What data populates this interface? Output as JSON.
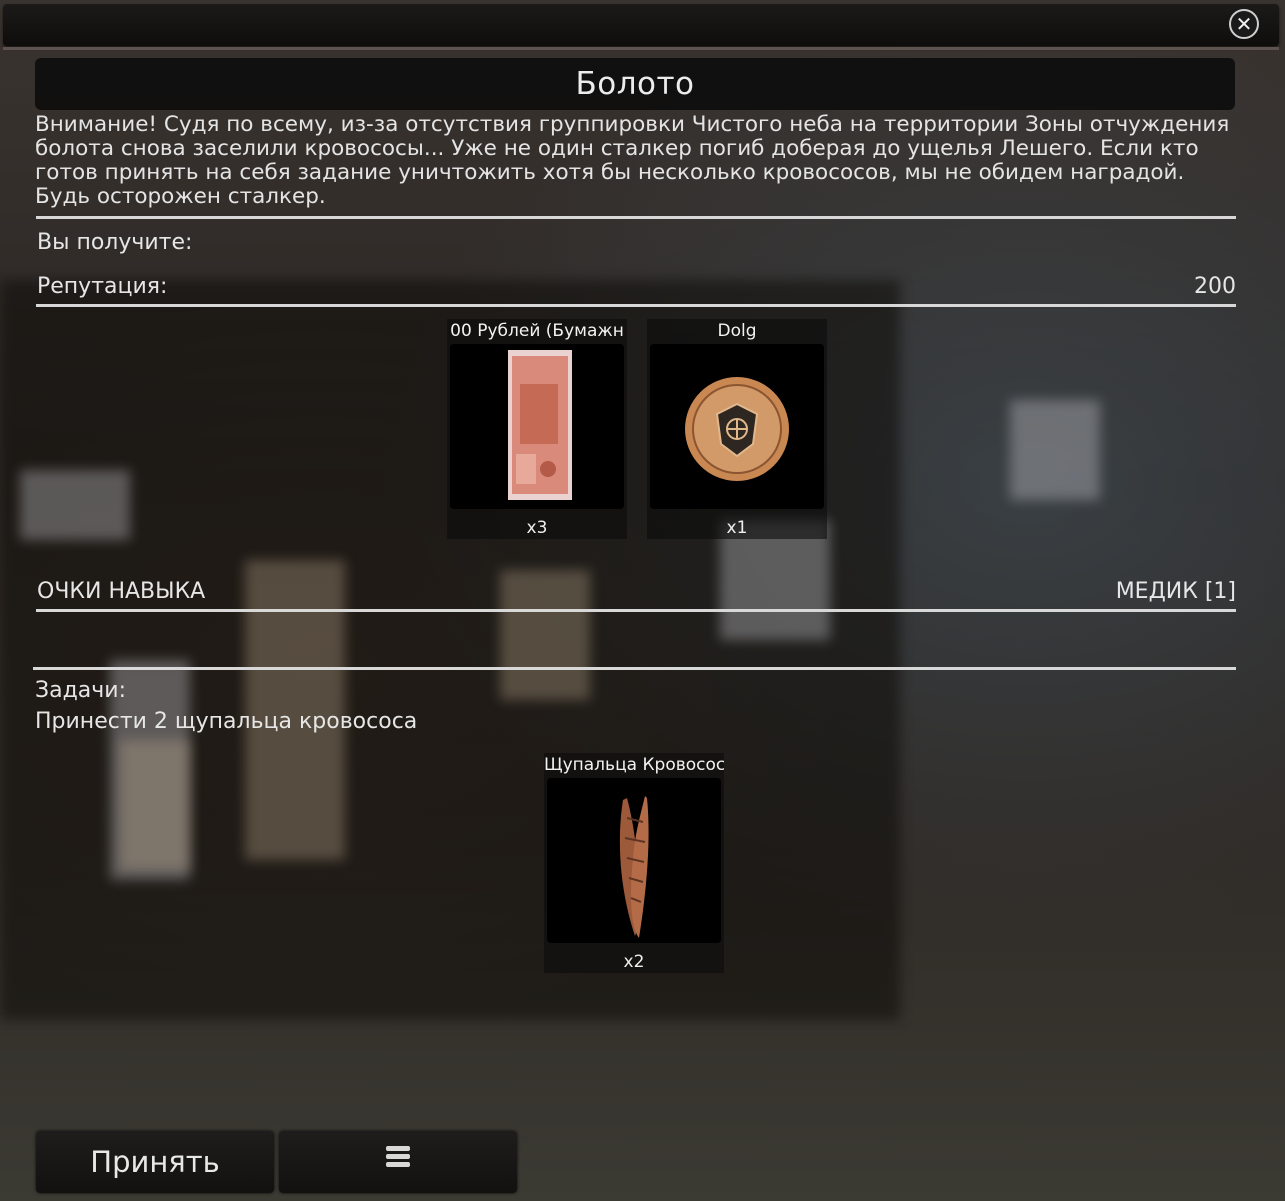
{
  "dialog": {
    "close_symbol": "✕",
    "title": "Болото",
    "description": "Внимание! Судя по всему, из-за отсутствия группировки Чистого неба на территории Зоны отчуждения болота снова заселили кровососы... Уже не один сталкер погиб доберая до ущелья Лешего. Если кто готов принять на себя задание уничтожить хотя бы несколько кровососов, мы не обидем наградой. Будь осторожен сталкер."
  },
  "rewards": {
    "header": "Вы получите:",
    "reputation_label": "Репутация:",
    "reputation_value": "200",
    "items": [
      {
        "name": "00 Рублей (Бумажн",
        "count": "x3",
        "icon": "banknote-icon"
      },
      {
        "name": "Dolg",
        "count": "x1",
        "icon": "dolg-coin-icon"
      }
    ],
    "skill_label": "ОЧКИ НАВЫКА",
    "skill_value": "МЕДИК [1]"
  },
  "tasks": {
    "header": "Задачи:",
    "text": "Принести 2 щупальца кровососа",
    "items": [
      {
        "name": "Щупальца Кровосос",
        "count": "x2",
        "icon": "tentacle-icon"
      }
    ]
  },
  "footer": {
    "accept_label": "Принять",
    "second_icon": "list-icon"
  },
  "colors": {
    "accent_line": "#d8d8d8",
    "panel_bg": "#0e0d0c"
  }
}
